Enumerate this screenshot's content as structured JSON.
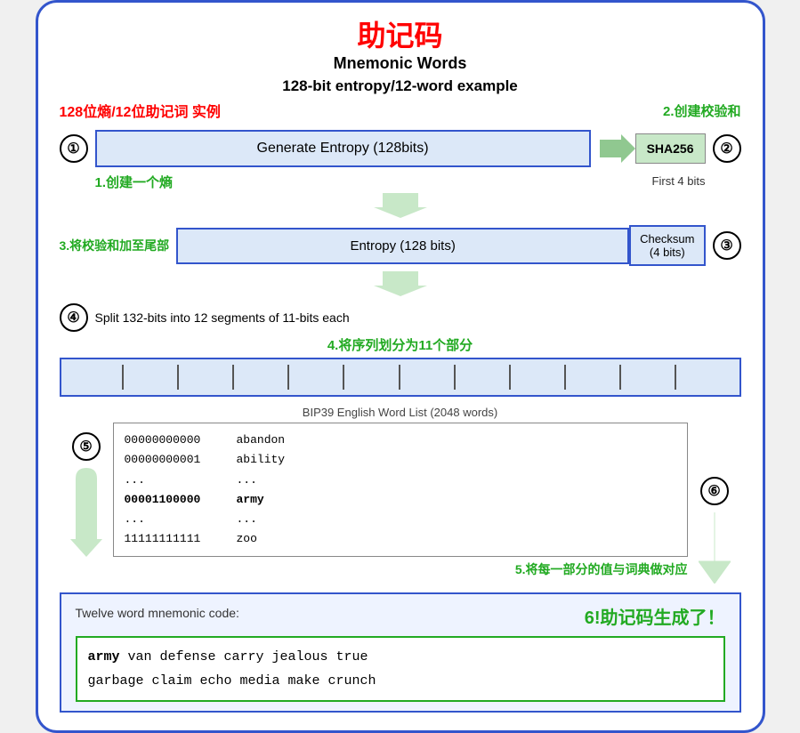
{
  "title": {
    "zh": "助记码",
    "en_line1": "Mnemonic Words",
    "en_line2": "128-bit entropy/12-word example",
    "zh_sub": "128位熵/12位助记词 实例"
  },
  "labels": {
    "step1": "1.创建一个熵",
    "step2": "2.创建校验和",
    "step3": "3.将校验和加至尾部",
    "step4_en": "Split 132-bits into 12 segments of 11-bits each",
    "step4_zh": "4.将序列划分为11个部分",
    "step5": "5.将每一部分的值与词典做对应",
    "step6": "6!助记码生成了！"
  },
  "boxes": {
    "generate_entropy": "Generate Entropy (128bits)",
    "sha256": "SHA256",
    "first4bits": "First 4 bits",
    "entropy128": "Entropy (128 bits)",
    "checksum": "Checksum\n(4 bits)"
  },
  "wordlist": {
    "label": "BIP39 English Word List (2048 words)",
    "col1": [
      "00000000000",
      "00000000001",
      "...",
      "00001100000",
      "...",
      "11111111111"
    ],
    "col2": [
      "abandon",
      "ability",
      "...",
      "army",
      "...",
      "zoo"
    ]
  },
  "mnemonic": {
    "label": "Twelve word mnemonic code:",
    "words": "army van defense carry jealous true garbage claim echo media make crunch",
    "first_word": "army"
  },
  "circles": {
    "1": "①",
    "2": "②",
    "3": "③",
    "4": "④",
    "5": "⑤",
    "6": "⑥"
  }
}
